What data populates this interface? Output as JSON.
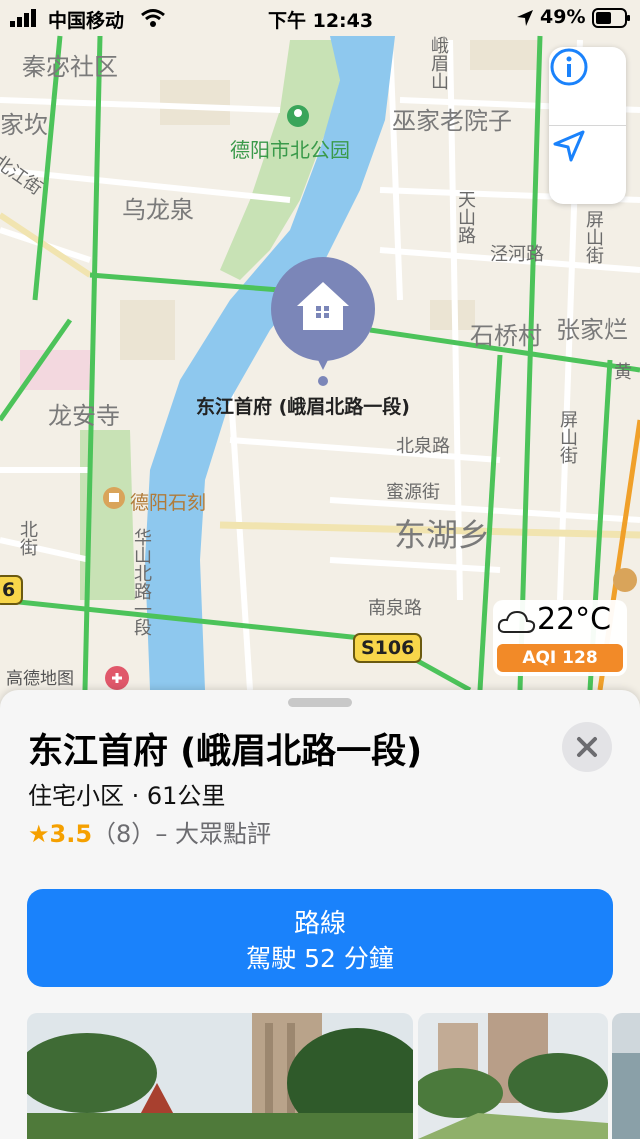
{
  "status_bar": {
    "carrier": "中国移动",
    "time": "下午 12:43",
    "battery": "49%"
  },
  "map": {
    "districts": [
      "秦宓社区",
      "家坎",
      "巫家老院子",
      "乌龙泉",
      "石桥村",
      "张家烂",
      "龙安寺",
      "东湖乡"
    ],
    "parks": [
      "德阳市北公园"
    ],
    "pois": [
      "德阳石刻"
    ],
    "streets": [
      "北江街",
      "峨眉山",
      "天山路",
      "泾河路",
      "屏山街",
      "北泉路",
      "蜜源街",
      "南泉路",
      "黄",
      "北街",
      "华山北路一段",
      "屏山街"
    ],
    "road_badges": [
      "S106",
      "6"
    ],
    "attribution": "高德地图",
    "weather": {
      "temp": "22°C",
      "aqi": "AQI 128"
    },
    "pin_label": "东江首府 (峨眉北路一段)"
  },
  "sheet": {
    "title": "东江首府 (峨眉北路一段)",
    "subtitle": "住宅小区 · 61公里",
    "rating": {
      "star": "★",
      "score": "3.5",
      "count": "（8）",
      "source": "– 大眾點評"
    },
    "route": {
      "label": "路線",
      "detail": "駕駛 52 分鐘"
    }
  },
  "colors": {
    "accent": "#1a82fb",
    "water": "#8ec8ee",
    "road_green": "#4cc35a",
    "pin": "#7b86b8",
    "aqi": "#f28a28"
  }
}
